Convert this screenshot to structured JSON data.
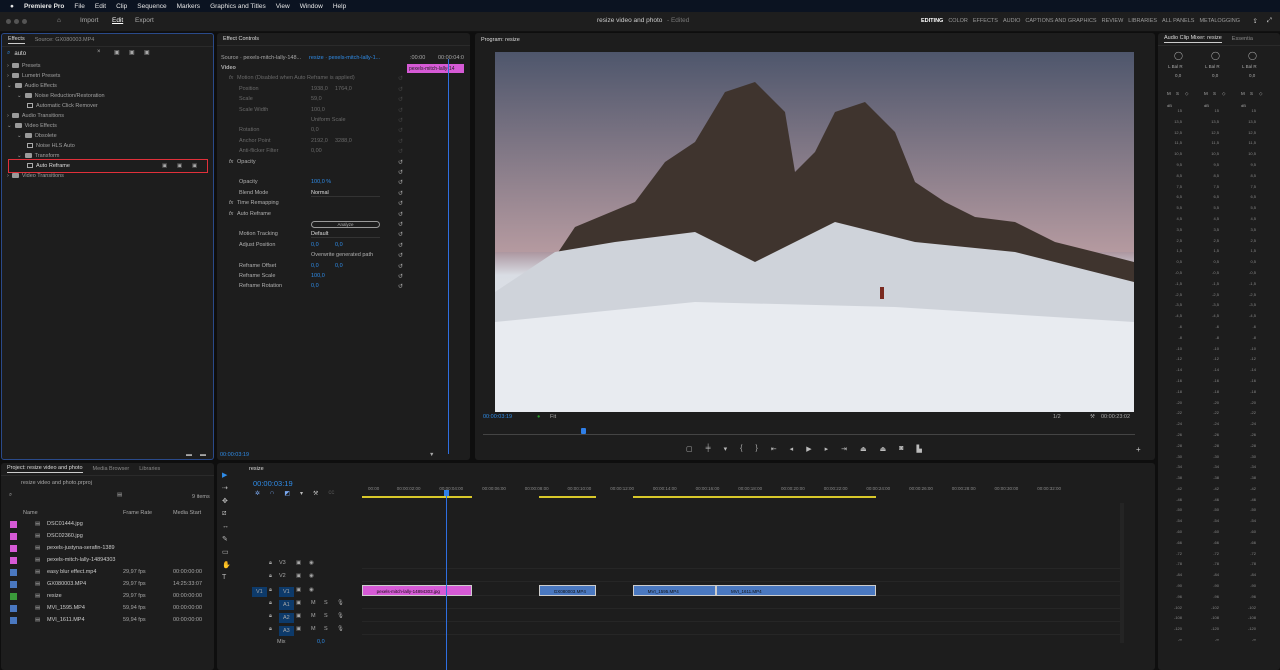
{
  "menubar": {
    "app": "Premiere Pro",
    "items": [
      "File",
      "Edit",
      "Clip",
      "Sequence",
      "Markers",
      "Graphics and Titles",
      "View",
      "Window",
      "Help"
    ]
  },
  "header": {
    "nav": [
      "Import",
      "Edit",
      "Export"
    ],
    "title": "resize video and photo",
    "status": "- Edited",
    "workspaces": [
      "EDITING",
      "COLOR",
      "EFFECTS",
      "AUDIO",
      "CAPTIONS AND GRAPHICS",
      "REVIEW",
      "LIBRARIES",
      "ALL PANELS",
      "METALOGGING"
    ]
  },
  "effects": {
    "tabs": [
      "Effects",
      "Source: GX080003.MP4"
    ],
    "search": "auto",
    "tree": [
      {
        "label": "Presets",
        "lvl": 0,
        "t": "f"
      },
      {
        "label": "Lumetri Presets",
        "lvl": 0,
        "t": "f"
      },
      {
        "label": "Audio Effects",
        "lvl": 0,
        "t": "f"
      },
      {
        "label": "Noise Reduction/Restoration",
        "lvl": 1,
        "t": "f"
      },
      {
        "label": "Automatic Click Remover",
        "lvl": 2,
        "t": "e"
      },
      {
        "label": "Audio Transitions",
        "lvl": 0,
        "t": "f"
      },
      {
        "label": "Video Effects",
        "lvl": 0,
        "t": "f"
      },
      {
        "label": "Obsolete",
        "lvl": 1,
        "t": "f"
      },
      {
        "label": "Noise HLS Auto",
        "lvl": 2,
        "t": "e"
      },
      {
        "label": "Transform",
        "lvl": 1,
        "t": "f"
      },
      {
        "label": "Auto Reframe",
        "lvl": 2,
        "t": "e",
        "selected": true
      },
      {
        "label": "Video Transitions",
        "lvl": 0,
        "t": "f"
      }
    ]
  },
  "effect_controls": {
    "title": "Effect Controls",
    "source": "Source · pexels-mitch-lally-148...",
    "sequence": "resize · pexels-mitch-lally-1...",
    "mini_clip": "pexels-mitch-lally-14",
    "ruler": [
      ":00:00",
      "00:00:04:0"
    ],
    "timecode": "00:00:03:19",
    "rows": [
      {
        "label": "Video",
        "v1": "",
        "v2": "",
        "ind": 0,
        "hdr": true
      },
      {
        "label": "Motion  (Disabled when Auto Reframe is applied)",
        "v1": "",
        "v2": "",
        "ind": 1,
        "dim": true
      },
      {
        "label": "Position",
        "v1": "1938,0",
        "v2": "1764,0",
        "ind": 2,
        "dim": true
      },
      {
        "label": "Scale",
        "v1": "59,0",
        "v2": "",
        "ind": 2,
        "dim": true
      },
      {
        "label": "Scale Width",
        "v1": "100,0",
        "v2": "",
        "ind": 2,
        "dim": true
      },
      {
        "label": "",
        "v1": "Uniform Scale",
        "v2": "",
        "ind": 2,
        "dim": true
      },
      {
        "label": "Rotation",
        "v1": "0,0",
        "v2": "",
        "ind": 2,
        "dim": true
      },
      {
        "label": "Anchor Point",
        "v1": "2192,0",
        "v2": "3288,0",
        "ind": 2,
        "dim": true
      },
      {
        "label": "Anti-flicker Filter",
        "v1": "0,00",
        "v2": "",
        "ind": 2,
        "dim": true
      },
      {
        "label": "Opacity",
        "v1": "",
        "v2": "",
        "ind": 1
      },
      {
        "label": "",
        "v1": "",
        "v2": "",
        "ind": 2
      },
      {
        "label": "Opacity",
        "v1": "100,0 %",
        "v2": "",
        "ind": 2,
        "blue": true
      },
      {
        "label": "Blend Mode",
        "v1": "Normal",
        "v2": "",
        "ind": 2
      },
      {
        "label": "Time Remapping",
        "v1": "",
        "v2": "",
        "ind": 1
      },
      {
        "label": "Auto Reframe",
        "v1": "",
        "v2": "",
        "ind": 1
      },
      {
        "label": "",
        "v1": "Analyze",
        "v2": "",
        "ind": 2
      },
      {
        "label": "Motion Tracking",
        "v1": "Default",
        "v2": "",
        "ind": 2
      },
      {
        "label": "Adjust Position",
        "v1": "0,0",
        "v2": "0,0",
        "ind": 2,
        "blue": true
      },
      {
        "label": "",
        "v1": "Overwrite generated path",
        "v2": "",
        "ind": 2
      },
      {
        "label": "Reframe Offset",
        "v1": "0,0",
        "v2": "0,0",
        "ind": 2,
        "blue": true
      },
      {
        "label": "Reframe Scale",
        "v1": "100,0",
        "v2": "",
        "ind": 2,
        "blue": true
      },
      {
        "label": "Reframe Rotation",
        "v1": "0,0",
        "v2": "",
        "ind": 2,
        "blue": true
      }
    ]
  },
  "program": {
    "title": "Program: resize",
    "timecode": "00:00:03:19",
    "fit": "Fit",
    "resolution": "1/2",
    "duration": "00:00:23:02",
    "playhead_fraction": 0.15
  },
  "mixer": {
    "tabs": [
      "Audio Clip Mixer: resize",
      "Essentia"
    ],
    "channels": [
      {
        "pan": "0,0"
      },
      {
        "pan": "0,0"
      },
      {
        "pan": "0,0"
      }
    ],
    "lr": "L  Bal  R",
    "msr": [
      "M",
      "S",
      "◇"
    ],
    "db_label": "dB",
    "db": [
      "15",
      "13,5",
      "12,5",
      "11,5",
      "10,5",
      "9,5",
      "8,5",
      "7,5",
      "6,5",
      "5,5",
      "4,5",
      "3,5",
      "2,5",
      "1,5",
      "0,5",
      "-0,5",
      "-1,5",
      "-2,5",
      "-3,5",
      "-4,5",
      "-6",
      "-8",
      "-10",
      "-12",
      "-14",
      "-16",
      "-18",
      "-20",
      "-22",
      "-24",
      "-26",
      "-28",
      "-30",
      "-34",
      "-38",
      "-42",
      "-46",
      "-50",
      "-54",
      "-60",
      "-66",
      "-72",
      "-78",
      "-84",
      "-90",
      "-96",
      "-102",
      "-108",
      "-120",
      "-∞"
    ]
  },
  "project": {
    "tabs": [
      "Project: resize video and photo",
      "Media Browser",
      "Libraries"
    ],
    "file": "resize video and photo.prproj",
    "count": "9 items",
    "columns": [
      "Name",
      "Frame Rate",
      "Media Start"
    ],
    "items": [
      {
        "name": "DSC01444.jpg",
        "color": "#d65ad6",
        "fps": "",
        "start": ""
      },
      {
        "name": "DSC02360.jpg",
        "color": "#d65ad6",
        "fps": "",
        "start": ""
      },
      {
        "name": "pexels-justyna-serafin-1389",
        "color": "#d65ad6",
        "fps": "",
        "start": ""
      },
      {
        "name": "pexels-mitch-lally-14894303",
        "color": "#d65ad6",
        "fps": "",
        "start": ""
      },
      {
        "name": "easy blur effect.mp4",
        "color": "#4a78c0",
        "fps": "29,97 fps",
        "start": "00:00:00:00"
      },
      {
        "name": "GX080003.MP4",
        "color": "#4a78c0",
        "fps": "29,97 fps",
        "start": "14:25:33:07"
      },
      {
        "name": "resize",
        "color": "#3a9a3a",
        "fps": "29,97 fps",
        "start": "00:00:00:00"
      },
      {
        "name": "MVI_1595.MP4",
        "color": "#4a78c0",
        "fps": "59,94 fps",
        "start": "00:00:00:00"
      },
      {
        "name": "MVI_1611.MP4",
        "color": "#4a78c0",
        "fps": "59,94 fps",
        "start": "00:00:00:00"
      }
    ]
  },
  "timeline": {
    "tab": "resize",
    "timecode": "00:00:03:19",
    "ruler": [
      "00:00",
      "00:00:02:00",
      "00:00:04:00",
      "00:00:06:00",
      "00:00:08:00",
      "00:00:10:00",
      "00:00:12:00",
      "00:00:14:00",
      "00:00:16:00",
      "00:00:18:00",
      "00:00:20:00",
      "00:00:22:00",
      "00:00:24:00",
      "00:00:26:00",
      "00:00:28:00",
      "00:00:30:00",
      "00:00:32:00"
    ],
    "tracks": [
      "V3",
      "V2",
      "V1",
      "A1",
      "A2",
      "A3"
    ],
    "mix_label": "Mix",
    "mix_value": "0,0",
    "source_patch": "V1",
    "clips": [
      {
        "name": "pexels-mitch-lally-14894303.jpg",
        "start_s": -0.3,
        "end_s": 4.85,
        "color": "#d65ad6"
      },
      {
        "name": "GX080003.MP4",
        "start_s": 8.0,
        "end_s": 10.7,
        "color": "#4a78c0"
      },
      {
        "name": "MVI_1595.MP4",
        "start_s": 12.4,
        "end_s": 16.3,
        "color": "#4a78c0"
      },
      {
        "name": "MVI_1611.MP4",
        "start_s": 16.3,
        "end_s": 23.8,
        "color": "#4a78c0"
      }
    ],
    "playhead_s": 3.63
  }
}
